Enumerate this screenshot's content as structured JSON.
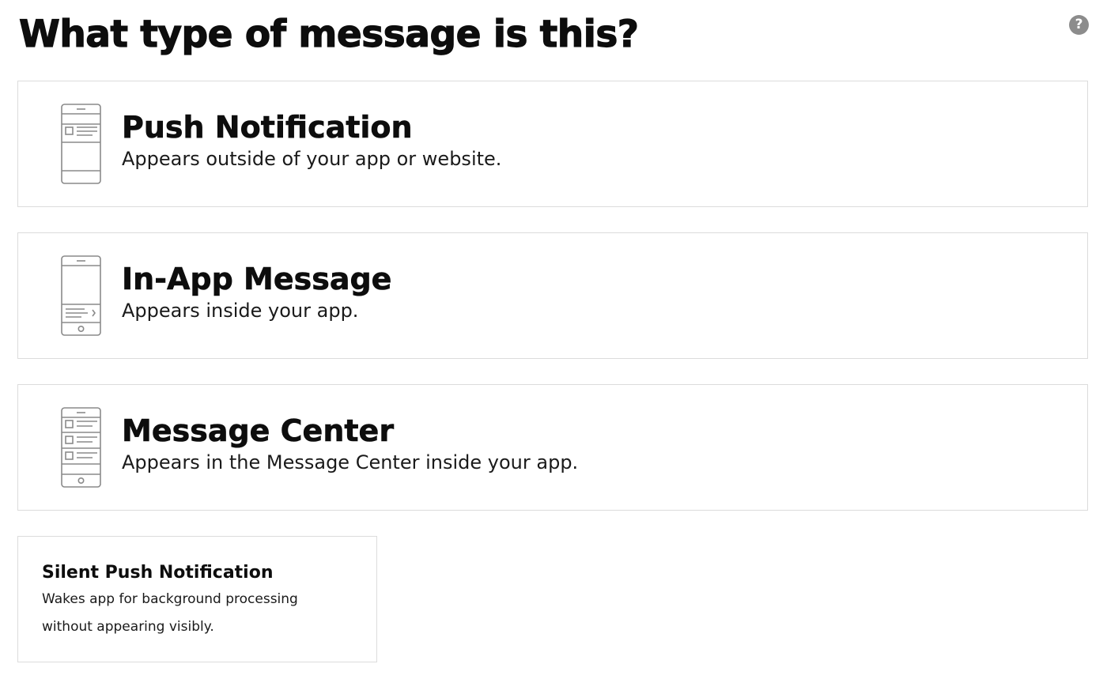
{
  "header": {
    "title": "What type of message is this?",
    "help_icon": "question-circle-icon",
    "help_glyph": "?"
  },
  "colors": {
    "text": "#0d0d0d",
    "border": "#dcdcdc",
    "icon_stroke": "#8a8a8a",
    "help_bg": "#8c8c8c"
  },
  "options": [
    {
      "title": "Push Notification",
      "description": "Appears outside of your app or website.",
      "icon": "phone-push-notification-icon"
    },
    {
      "title": "In-App Message",
      "description": "Appears inside your app.",
      "icon": "phone-in-app-message-icon"
    },
    {
      "title": "Message Center",
      "description": "Appears in the Message Center inside your app.",
      "icon": "phone-message-center-icon"
    }
  ],
  "silent": {
    "title": "Silent Push Notification",
    "description": "Wakes app for background processing without appearing visibly."
  }
}
